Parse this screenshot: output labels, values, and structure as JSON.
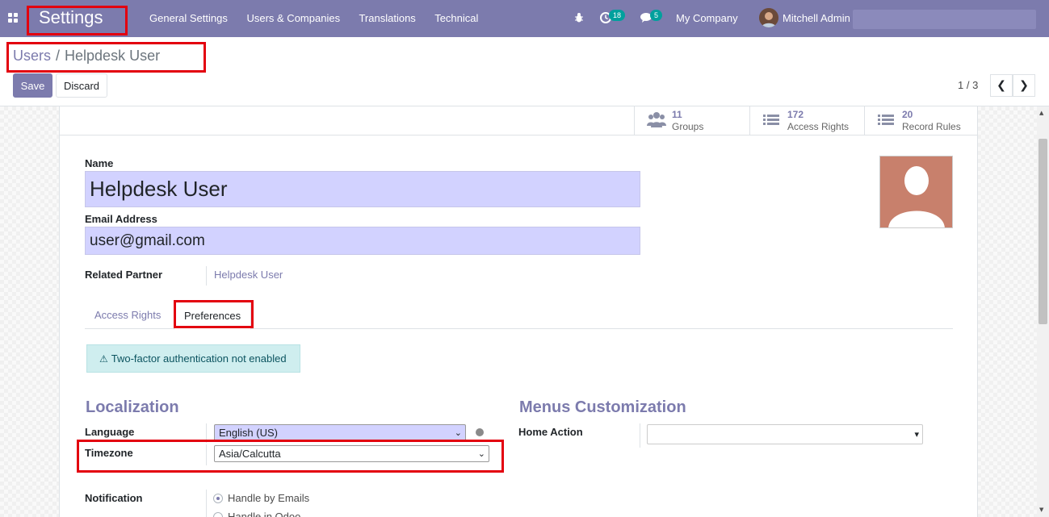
{
  "navbar": {
    "brand": "Settings",
    "menu": [
      "General Settings",
      "Users & Companies",
      "Translations",
      "Technical"
    ],
    "activity_count": "18",
    "message_count": "5",
    "company": "My Company",
    "user": "Mitchell Admin"
  },
  "breadcrumb": {
    "parent": "Users",
    "separator": "/",
    "current": "Helpdesk User"
  },
  "buttons": {
    "save": "Save",
    "discard": "Discard"
  },
  "pager": {
    "value": "1 / 3",
    "prev": "❮",
    "next": "❯"
  },
  "stat_buttons": [
    {
      "value": "11",
      "label": "Groups",
      "icon": "users-icon"
    },
    {
      "value": "172",
      "label": "Access Rights",
      "icon": "list-icon"
    },
    {
      "value": "20",
      "label": "Record Rules",
      "icon": "list-icon"
    }
  ],
  "form": {
    "name_label": "Name",
    "name_value": "Helpdesk User",
    "email_label": "Email Address",
    "email_value": "user@gmail.com",
    "partner_label": "Related Partner",
    "partner_value": "Helpdesk User"
  },
  "tabs": {
    "access_rights": "Access Rights",
    "preferences": "Preferences"
  },
  "alert": {
    "icon": "⚠",
    "text": "Two-factor authentication not enabled"
  },
  "localization": {
    "title": "Localization",
    "language_label": "Language",
    "language_value": "English (US)",
    "timezone_label": "Timezone",
    "timezone_value": "Asia/Calcutta",
    "notification_label": "Notification",
    "notification_options": [
      "Handle by Emails",
      "Handle in Odoo"
    ]
  },
  "menus": {
    "title": "Menus Customization",
    "home_action_label": "Home Action",
    "home_action_value": ""
  },
  "colors": {
    "brand": "#7c7bad",
    "highlight": "#e3000f",
    "input_bg": "#d2d2ff"
  }
}
